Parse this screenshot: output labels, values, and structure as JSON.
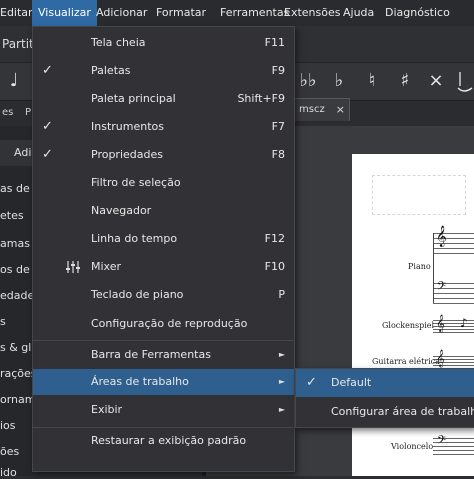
{
  "menubar": {
    "items": [
      "Editar",
      "Visualizar",
      "Adicionar",
      "Formatar",
      "Ferramentas",
      "Extensões",
      "Ajuda",
      "Diagnóstico"
    ]
  },
  "toolbar": {
    "partial_title": "Partitu"
  },
  "note_symbols": [
    "♩",
    "♭♭",
    "♭",
    "♮",
    "♯",
    "×"
  ],
  "tabs": {
    "left_tab": "es",
    "left_tab2": "P",
    "doc_tab": "mscz",
    "doc_close": "×",
    "left_button": "Adi"
  },
  "left_panel_items": [
    "as de N",
    "etes",
    "amas c",
    "os de v",
    "edade",
    "s",
    "s & gl",
    "rações",
    "ornam",
    "ios",
    "ões",
    "ido"
  ],
  "score": {
    "instruments": [
      "Piano",
      "Glockenspiel",
      "Guitarra elétrica",
      "Violoncelo"
    ]
  },
  "view_menu": {
    "items": [
      {
        "label": "Tela cheia",
        "shortcut": "F11",
        "checked": false
      },
      {
        "label": "Paletas",
        "shortcut": "F9",
        "checked": true
      },
      {
        "label": "Paleta principal",
        "shortcut": "Shift+F9",
        "checked": false
      },
      {
        "label": "Instrumentos",
        "shortcut": "F7",
        "checked": true
      },
      {
        "label": "Propriedades",
        "shortcut": "F8",
        "checked": true
      },
      {
        "label": "Filtro de seleção",
        "shortcut": "",
        "checked": false
      },
      {
        "label": "Navegador",
        "shortcut": "",
        "checked": false
      },
      {
        "label": "Linha do tempo",
        "shortcut": "F12",
        "checked": false
      },
      {
        "label": "Mixer",
        "shortcut": "F10",
        "checked": false,
        "icon": "mixer-icon"
      },
      {
        "label": "Teclado de piano",
        "shortcut": "P",
        "checked": false
      },
      {
        "label": "Configuração de reprodução",
        "shortcut": "",
        "checked": false
      }
    ],
    "submenus": [
      {
        "label": "Barra de Ferramentas"
      },
      {
        "label": "Áreas de trabalho"
      },
      {
        "label": "Exibir"
      }
    ],
    "restore": "Restaurar a exibição padrão",
    "check_glyph": "✓",
    "arrow_glyph": "►"
  },
  "workspace_submenu": {
    "items": [
      {
        "label": "Default",
        "checked": true
      },
      {
        "label": "Configurar área de trabalho",
        "checked": false
      }
    ]
  },
  "colors": {
    "accent": "#2f6aa5",
    "highlight": "#2f5f8e",
    "menu_bg": "#323236"
  }
}
